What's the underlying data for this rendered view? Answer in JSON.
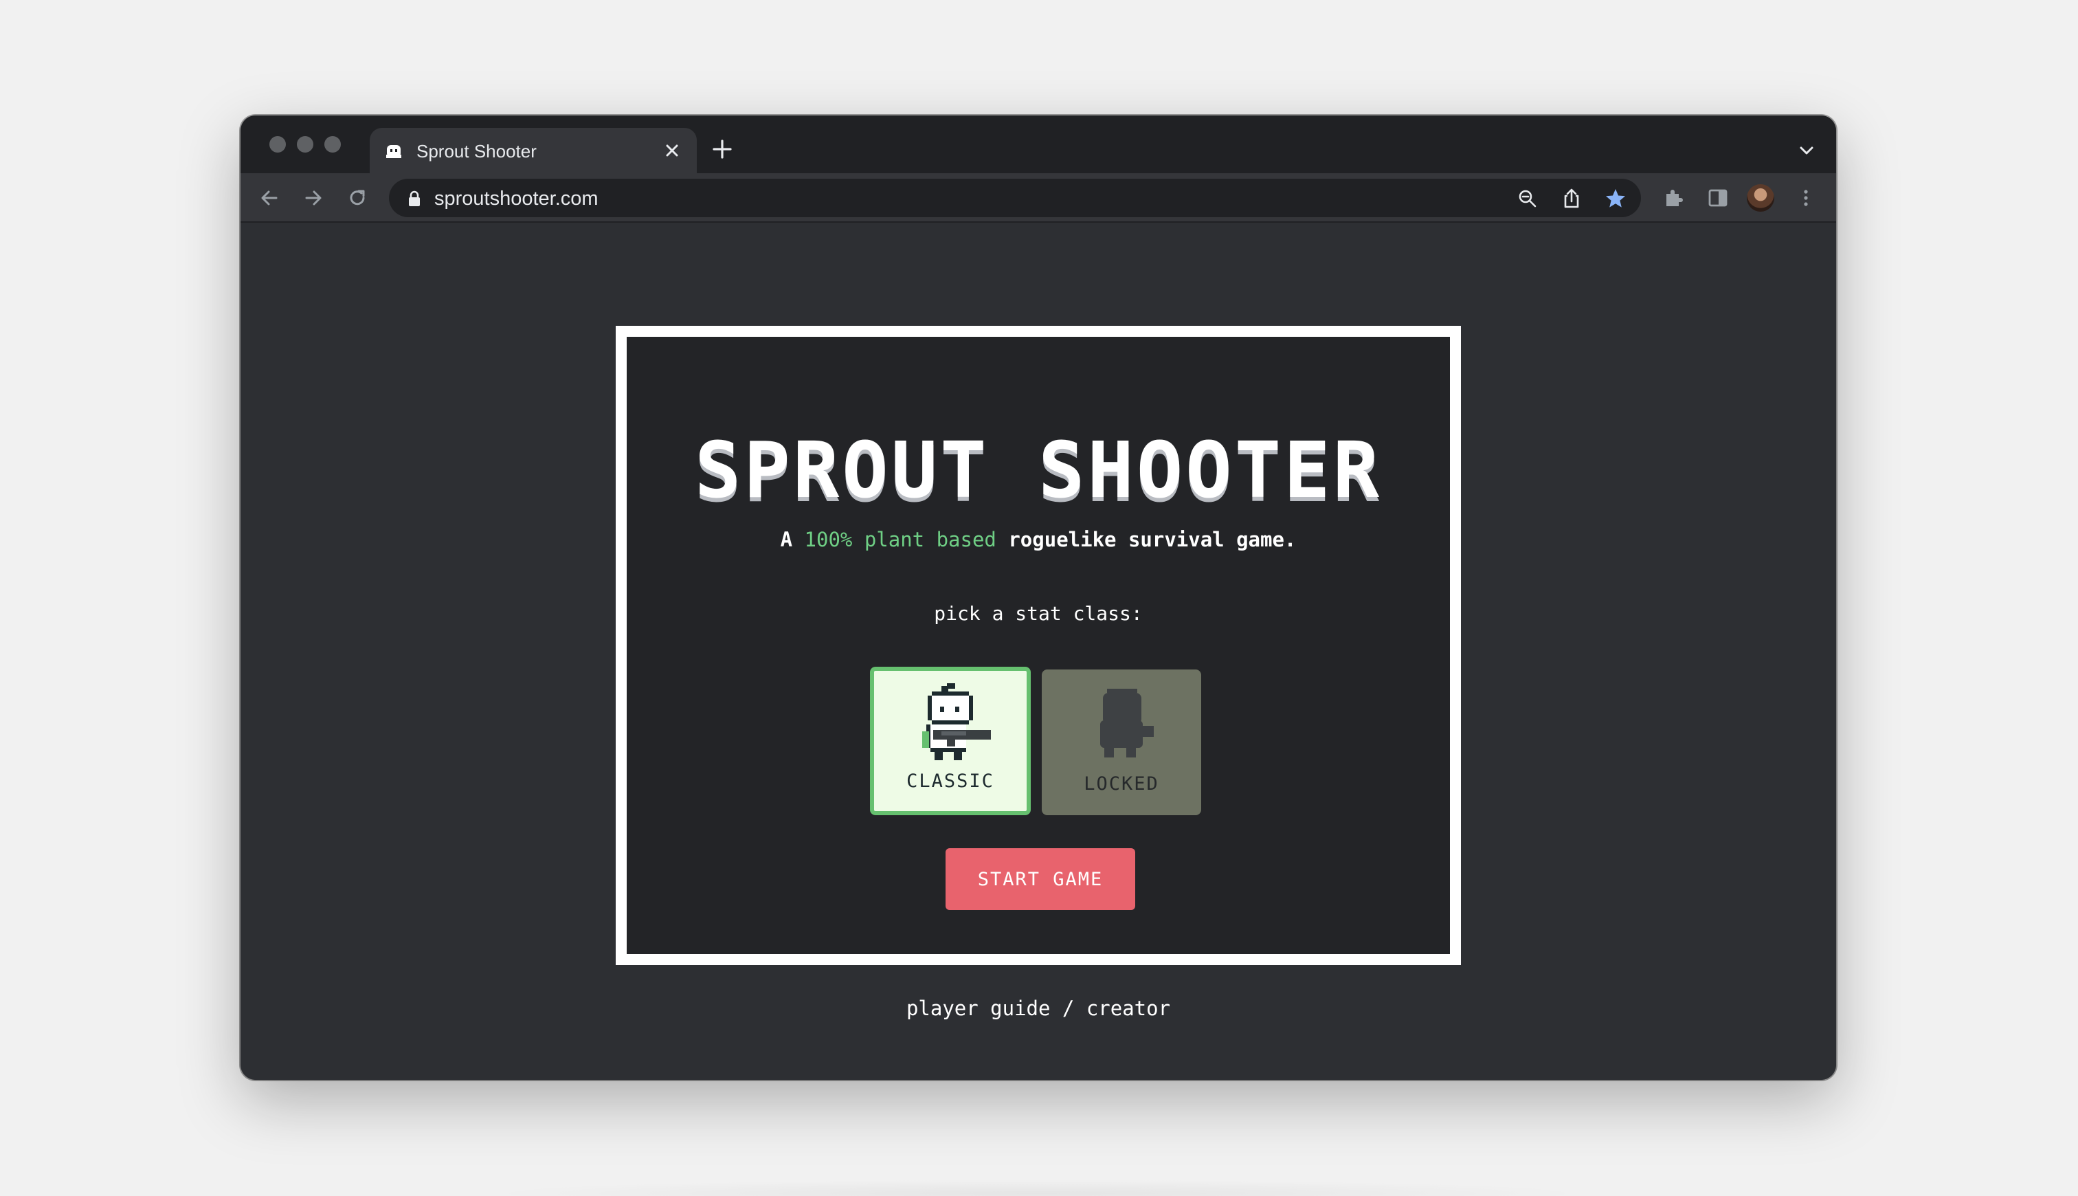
{
  "browser": {
    "tab_title": "Sprout Shooter",
    "url": "sproutshooter.com"
  },
  "game": {
    "title": "SPROUT SHOOTER",
    "tagline": {
      "prefix": "A ",
      "highlight": "100% plant based",
      "suffix": " roguelike survival game."
    },
    "class_prompt": "pick a stat class:",
    "classes": [
      {
        "label": "CLASSIC",
        "selected": true,
        "locked": false
      },
      {
        "label": "LOCKED",
        "selected": false,
        "locked": true
      }
    ],
    "start_button": "START GAME",
    "footer": {
      "guide_link": "player guide",
      "separator": " / ",
      "creator_link": "creator"
    }
  },
  "colors": {
    "accent_green": "#6fcf85",
    "start_button": "#e8636d",
    "classic_card_bg": "#eefbe6",
    "locked_card_bg": "#6d7262",
    "bookmark_star": "#8ab4f8"
  }
}
